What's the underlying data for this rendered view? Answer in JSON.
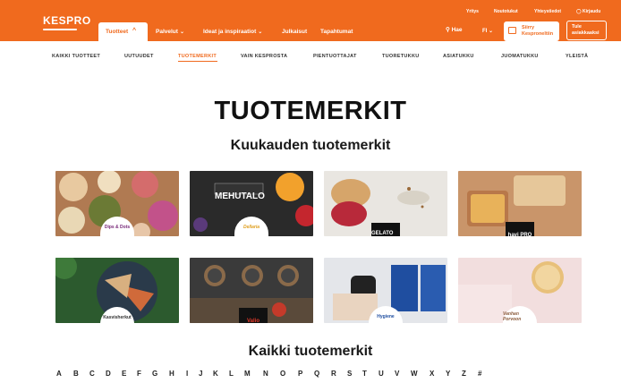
{
  "header": {
    "logo": "KESPRO",
    "utility_links": [
      "Yritys",
      "Noutotukut",
      "Yhteystiedot",
      "Kirjaudu"
    ],
    "nav": [
      {
        "label": "Tuotteet",
        "active": true
      },
      {
        "label": "Palvelut"
      },
      {
        "label": "Ideat ja inspiraatiot"
      },
      {
        "label": "Julkaisut"
      },
      {
        "label": "Tapahtumat"
      }
    ],
    "search_label": "Hae",
    "lang": "FI",
    "cta_primary": "Siirry Kesproneltiin",
    "cta_secondary": "Tule asiakkaaksi",
    "accent": "#f06a1e"
  },
  "subnav": [
    {
      "label": "KAIKKI TUOTTEET"
    },
    {
      "label": "UUTUUDET"
    },
    {
      "label": "TUOTEMERKIT",
      "active": true
    },
    {
      "label": "VAIN KESPROSTA"
    },
    {
      "label": "PIENTUOTTAJAT"
    },
    {
      "label": "TUORETUKKU"
    },
    {
      "label": "ASIATUKKU"
    },
    {
      "label": "JUOMATUKKU"
    },
    {
      "label": "YLEISTÄ"
    }
  ],
  "main": {
    "title": "TUOTEMERKIT",
    "month_title": "Kuukauden tuotemerkit",
    "all_title": "Kaikki tuotemerkit",
    "brands": [
      {
        "name": "Dips & Dots"
      },
      {
        "name": "Dellaria",
        "image_text": "MEHUTALO"
      },
      {
        "name": "GELATO LAB"
      },
      {
        "name": "havi PRO"
      },
      {
        "name": "Kasvisherkut"
      },
      {
        "name": "Valio"
      },
      {
        "name": "Hygiene"
      },
      {
        "name": "Vanhan Porvoon"
      }
    ],
    "alphabet": [
      "A",
      "B",
      "C",
      "D",
      "E",
      "F",
      "G",
      "H",
      "I",
      "J",
      "K",
      "L",
      "M",
      "N",
      "O",
      "P",
      "Q",
      "R",
      "S",
      "T",
      "U",
      "V",
      "W",
      "X",
      "Y",
      "Z",
      "#"
    ]
  }
}
